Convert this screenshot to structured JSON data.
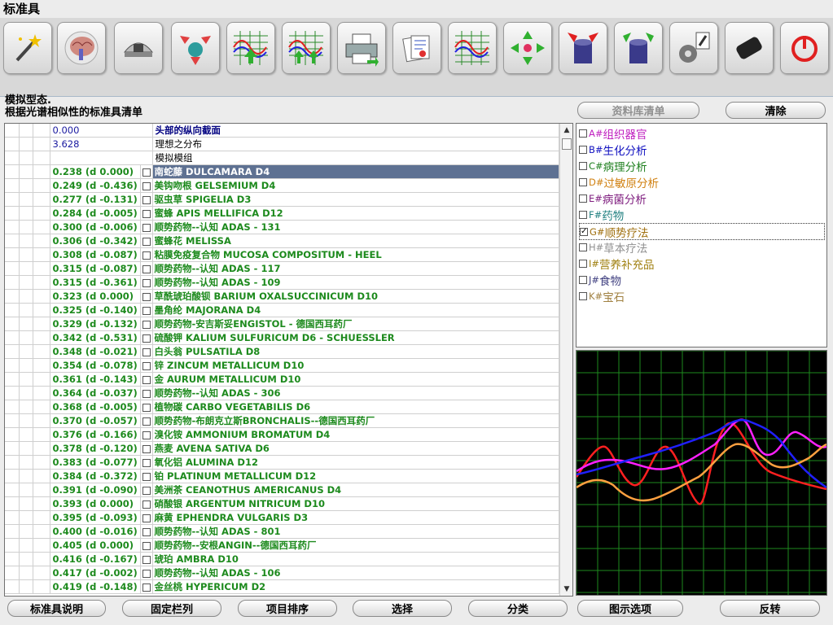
{
  "window": {
    "title": "标准具"
  },
  "toolbar": {
    "buttons": [
      {
        "icon": "magic-wand-icon"
      },
      {
        "icon": "brain-scan-icon"
      },
      {
        "icon": "scanner-device-icon"
      },
      {
        "icon": "three-arrows-icon"
      },
      {
        "icon": "wave-up-icon"
      },
      {
        "icon": "wave-double-up-icon"
      },
      {
        "icon": "printer-icon"
      },
      {
        "icon": "report-pages-icon"
      },
      {
        "icon": "spectrum-grid-icon"
      },
      {
        "icon": "four-direction-arrows-icon"
      },
      {
        "icon": "cylinder-arrows-in-icon"
      },
      {
        "icon": "cylinder-arrows-out-icon"
      },
      {
        "icon": "microscope-gear-icon"
      },
      {
        "icon": "eraser-icon"
      },
      {
        "icon": "power-icon"
      }
    ]
  },
  "status": {
    "line1": "模拟型态.",
    "line2": "根据光谱相似性的标准具清单"
  },
  "buttons": {
    "database_list": "资料库清单",
    "clear": "清除",
    "etalon_info": "标准具说明",
    "fixed_columns": "固定栏列",
    "sort_items": "项目排序",
    "select": "选择",
    "classify": "分类",
    "display_options": "图示选项",
    "invert": "反转"
  },
  "list": {
    "header_rows": [
      {
        "value": "0.000",
        "name": "头部的纵向截面"
      },
      {
        "value": "3.628",
        "name": "理想之分布"
      },
      {
        "value": "",
        "name": "模拟模组"
      }
    ],
    "rows": [
      {
        "value": "0.238 (d 0.000)",
        "name": "南蛇藤 DULCAMARA D4",
        "selected": true
      },
      {
        "value": "0.249 (d -0.436)",
        "name": "美钩吻根 GELSEMIUM D4"
      },
      {
        "value": "0.277 (d -0.131)",
        "name": "驱虫草 SPIGELIA D3"
      },
      {
        "value": "0.284 (d -0.005)",
        "name": "蜜蜂 APIS MELLIFICA D12"
      },
      {
        "value": "0.300 (d -0.006)",
        "name": "顺势药物--认知 ADAS - 131"
      },
      {
        "value": "0.306 (d -0.342)",
        "name": "蜜蜂花 MELISSA"
      },
      {
        "value": "0.308 (d -0.087)",
        "name": "粘膜免疫复合物 MUCOSA COMPOSITUM - HEEL"
      },
      {
        "value": "0.315 (d -0.087)",
        "name": "顺势药物--认知 ADAS - 117"
      },
      {
        "value": "0.315 (d -0.361)",
        "name": "顺势药物--认知 ADAS - 109"
      },
      {
        "value": "0.323 (d 0.000)",
        "name": "草酰琥珀酸钡 BARIUM OXALSUCCINICUM D10"
      },
      {
        "value": "0.325 (d -0.140)",
        "name": "墨角纶 MAJORANA D4"
      },
      {
        "value": "0.329 (d -0.132)",
        "name": "顺势药物-安吉斯妥ENGISTOL - 德国西耳药厂"
      },
      {
        "value": "0.342 (d -0.531)",
        "name": "硫酸钾 KALIUM SULFURICUM D6 - SCHUESSLER"
      },
      {
        "value": "0.348 (d -0.021)",
        "name": "白头翁 PULSATILA D8"
      },
      {
        "value": "0.354 (d -0.078)",
        "name": "锌 ZINCUM METALLICUM D10"
      },
      {
        "value": "0.361 (d -0.143)",
        "name": "金 AURUM METALLICUM D10"
      },
      {
        "value": "0.364 (d -0.037)",
        "name": "顺势药物--认知 ADAS - 306"
      },
      {
        "value": "0.368 (d -0.005)",
        "name": "植物碳 CARBO VEGETABILIS D6"
      },
      {
        "value": "0.370 (d -0.057)",
        "name": "顺势药物-布朗克立斯BRONCHALIS--德国西耳药厂"
      },
      {
        "value": "0.376 (d -0.166)",
        "name": "溴化铵 AMMONIUM BROMATUM D4"
      },
      {
        "value": "0.378 (d -0.120)",
        "name": "燕麦 AVENA SATIVA D6"
      },
      {
        "value": "0.383 (d -0.077)",
        "name": "氧化铝 ALUMINA D12"
      },
      {
        "value": "0.384 (d -0.372)",
        "name": "铂 PLATINUM METALLICUM D12"
      },
      {
        "value": "0.391 (d -0.090)",
        "name": "美洲茶 CEANOTHUS AMERICANUS D4"
      },
      {
        "value": "0.393 (d 0.000)",
        "name": "硝酸银 ARGENTUM NITRICUM D10"
      },
      {
        "value": "0.395 (d -0.093)",
        "name": "麻黄 EPHENDRA VULGARIS D3"
      },
      {
        "value": "0.400 (d -0.016)",
        "name": "顺势药物--认知 ADAS - 801"
      },
      {
        "value": "0.405 (d 0.000)",
        "name": "顺势药物--安根ANGIN--德国西耳药厂"
      },
      {
        "value": "0.416 (d -0.167)",
        "name": "琥珀 AMBRA D10"
      },
      {
        "value": "0.417 (d -0.002)",
        "name": "顺势药物--认知 ADAS - 106"
      },
      {
        "value": "0.419 (d -0.148)",
        "name": "金丝桃 HYPERICUM D2"
      }
    ]
  },
  "categories": [
    {
      "letter": "A",
      "label": "组织器官",
      "color": "#c020c0",
      "checked": false
    },
    {
      "letter": "B",
      "label": "生化分析",
      "color": "#1010c0",
      "checked": false
    },
    {
      "letter": "C",
      "label": "病理分析",
      "color": "#208020",
      "checked": false
    },
    {
      "letter": "D",
      "label": "过敏原分析",
      "color": "#d08010",
      "checked": false
    },
    {
      "letter": "E",
      "label": "病菌分析",
      "color": "#802080",
      "checked": false
    },
    {
      "letter": "F",
      "label": "药物",
      "color": "#208080",
      "checked": false
    },
    {
      "letter": "G",
      "label": "顺势疗法",
      "color": "#a07010",
      "checked": true
    },
    {
      "letter": "H",
      "label": "草本疗法",
      "color": "#909090",
      "checked": false
    },
    {
      "letter": "I",
      "label": "营养补充品",
      "color": "#a08010",
      "checked": false
    },
    {
      "letter": "J",
      "label": "食物",
      "color": "#404080",
      "checked": false
    },
    {
      "letter": "K",
      "label": "宝石",
      "color": "#a08040",
      "checked": false
    }
  ],
  "graph": {
    "colors": {
      "grid": "#1e8a1e",
      "red": "#ff2020",
      "magenta": "#ff20ff",
      "blue": "#2020ff",
      "orange": "#ffa040"
    }
  }
}
